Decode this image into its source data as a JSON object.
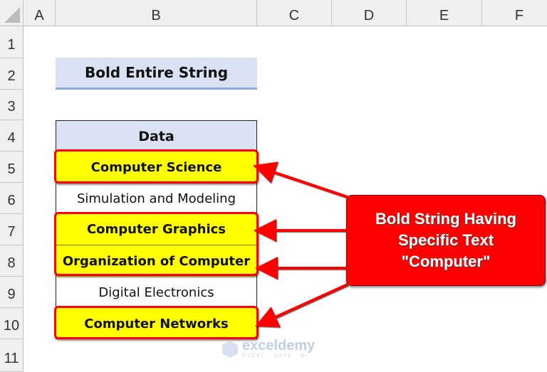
{
  "sheet": {
    "columns": [
      "A",
      "B",
      "C",
      "D",
      "E",
      "F"
    ],
    "rows": [
      "1",
      "2",
      "3",
      "4",
      "5",
      "6",
      "7",
      "8",
      "9",
      "10",
      "11"
    ]
  },
  "title_cell": "Bold Entire String",
  "table": {
    "header": "Data",
    "rows": [
      {
        "text": "Computer Science",
        "highlighted": true
      },
      {
        "text": "Simulation and Modeling",
        "highlighted": false
      },
      {
        "text": "Computer Graphics",
        "highlighted": true
      },
      {
        "text": "Organization of Computer",
        "highlighted": true
      },
      {
        "text": "Digital Electronics",
        "highlighted": false
      },
      {
        "text": "Computer Networks",
        "highlighted": true
      }
    ]
  },
  "callout": {
    "lines": [
      "Bold String Having",
      "Specific Text",
      "\"Computer\""
    ]
  },
  "watermark": {
    "name": "exceldemy",
    "tagline": "EXCEL · DATA · BI"
  },
  "colors": {
    "highlight_fill": "#ffff00",
    "highlight_border": "#ff0000",
    "header_fill": "#d9e1f2",
    "callout_fill": "#ff0000"
  }
}
